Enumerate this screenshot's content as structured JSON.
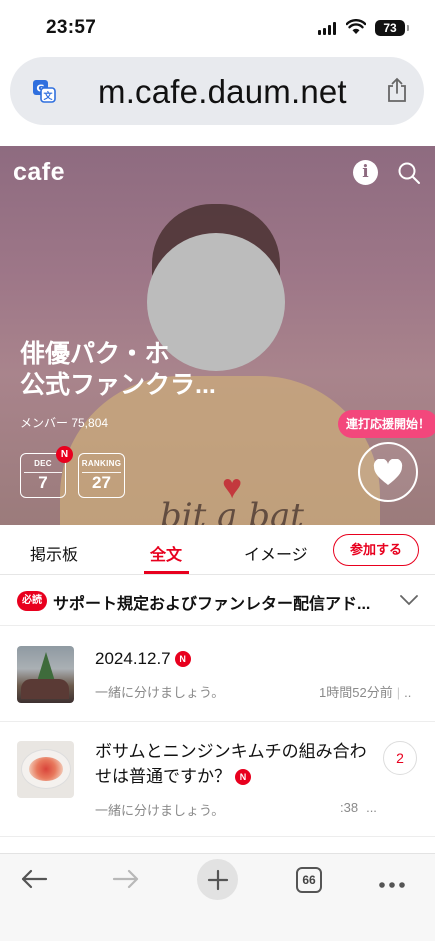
{
  "status_bar": {
    "time": "23:57",
    "battery": "73"
  },
  "browser": {
    "url": "m.cafe.daum.net"
  },
  "cafe": {
    "brand": "cafe",
    "title": "俳優パク・ホ\n公式ファンクラ...",
    "members": "メンバー 75,804",
    "cheer_button": "連打応援開始！",
    "calendar": {
      "label": "DEC",
      "value": "7",
      "badge": "N"
    },
    "ranking": {
      "label": "RANKING",
      "value": "27"
    },
    "shirt_text": "bit a bat"
  },
  "tabs": {
    "items": [
      {
        "label": "掲示板"
      },
      {
        "label": "全文"
      },
      {
        "label": "イメージ"
      }
    ],
    "active": "全文",
    "join_button": "参加する"
  },
  "notice": {
    "badge": "必読",
    "text": "サポート規定およびファンレター配信アド..."
  },
  "posts": [
    {
      "title": "2024.12.7",
      "badge": "N",
      "board": "一緒に分けましょう。",
      "time": "1時間52分前",
      "extra": ".."
    },
    {
      "title": "ボサムとニンジンキムチの組み合わせは普通ですか？",
      "badge": "N",
      "board": "一緒に分けましょう。",
      "time": ":38",
      "extra": "...",
      "comments": "2"
    }
  ],
  "toolbar": {
    "tab_count": "66"
  },
  "colors": {
    "accent": "#e8001e",
    "cheer": "#f3477c",
    "hero": "#9e7788"
  }
}
